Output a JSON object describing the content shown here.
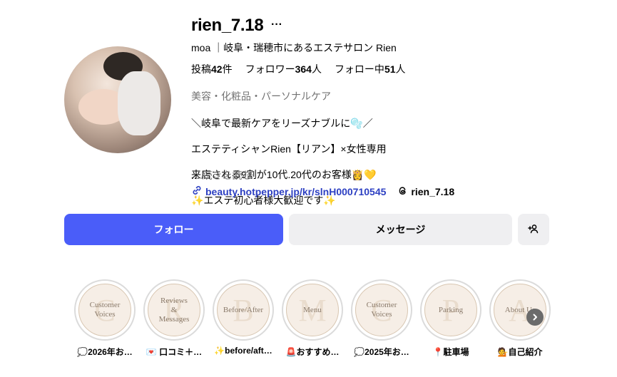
{
  "profile": {
    "username": "rien_7.18",
    "more_label": "···",
    "full_name": "moa ｜岐阜・瑞穂市にあるエステサロン Rien",
    "stats": {
      "posts_prefix": "投稿",
      "posts": "42",
      "posts_suffix": "件",
      "followers_prefix": "フォロワー",
      "followers": "364",
      "followers_suffix": "人",
      "following_prefix": "フォロー中",
      "following": "51",
      "following_suffix": "人"
    },
    "category": "美容・化粧品・パーソナルケア",
    "bio_lines": [
      "＼岐阜で最新ケアをリーズナブルに🫧／",
      "エステティシャンRien【リアン】×女性専用",
      "来店される9割が10代.20代のお客様👸💛",
      "✨エステ初心者様大歓迎です✨"
    ],
    "read_more_dots": "...",
    "read_more": " 続きを読む",
    "link": "beauty.hotpepper.jp/kr/slnH000710545",
    "threads_handle": "rien_7.18"
  },
  "actions": {
    "follow": "フォロー",
    "message": "メッセージ"
  },
  "highlights": [
    {
      "cover_text": "Customer\nVoices",
      "letter": "C",
      "label": "💭2026年お…"
    },
    {
      "cover_text": "Reviews\n&\nMessages",
      "letter": "R",
      "label": "💌 口コミ＋…"
    },
    {
      "cover_text": "Before/After",
      "letter": "B",
      "label": "✨before/aft…"
    },
    {
      "cover_text": "Menu",
      "letter": "M",
      "label": "🚨おすすめ…"
    },
    {
      "cover_text": "Customer\nVoices",
      "letter": "C",
      "label": "💭2025年お…"
    },
    {
      "cover_text": "Parking",
      "letter": "P",
      "label": "📍駐車場"
    },
    {
      "cover_text": "About Us",
      "letter": "A",
      "label": "💁自己紹介"
    }
  ],
  "colors": {
    "follow_button": "#4a5df9",
    "secondary_button": "#efeff1",
    "link": "#2c3fc2"
  },
  "icons": [
    "link-icon",
    "threads-icon",
    "add-user-icon",
    "chevron-right-icon"
  ]
}
